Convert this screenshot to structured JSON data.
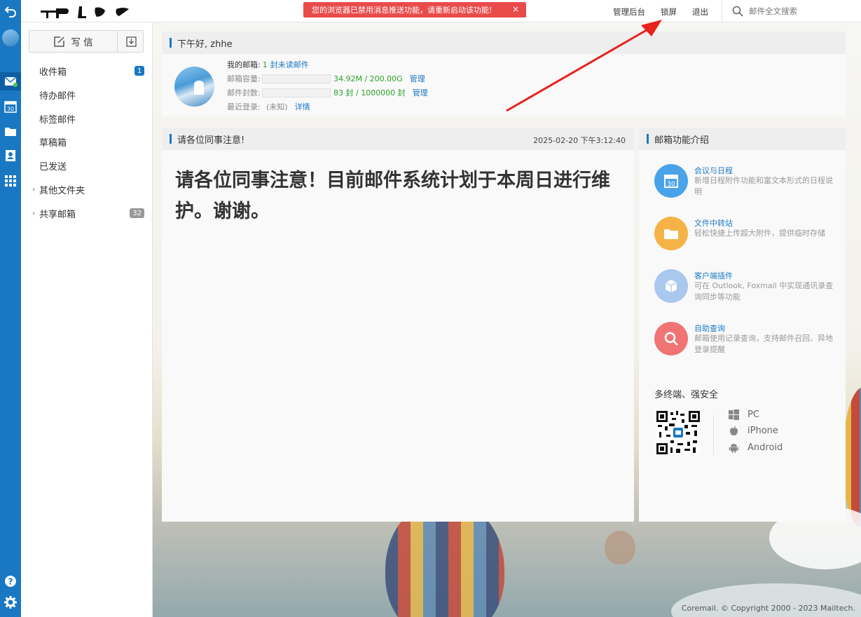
{
  "topbar": {
    "alert_text": "您的浏览器已禁用消息推送功能，请重新启动该功能!",
    "alert_close": "×",
    "admin_link": "管理后台",
    "lock_link": "锁屏",
    "logout_link": "退出",
    "search_placeholder": "邮件全文搜索"
  },
  "sidebar": {
    "compose_label": "写 信",
    "folders": [
      {
        "label": "收件箱",
        "badge": "1"
      },
      {
        "label": "待办邮件"
      },
      {
        "label": "标签邮件"
      },
      {
        "label": "草稿箱"
      },
      {
        "label": "已发送"
      },
      {
        "label": "其他文件夹"
      },
      {
        "label": "共享邮箱",
        "badge": "32"
      }
    ],
    "expand_arrow": "›"
  },
  "greeting": {
    "title": "下午好, zhhe",
    "mailbox_label": "我的邮箱:",
    "unread_count": "1",
    "unread_text": "封未读邮件",
    "capacity_label": "邮箱容量:",
    "capacity_value": "34.92M / 200.00G",
    "capacity_fraction": 0.0002,
    "count_label": "邮件封数:",
    "count_value": "83 封 / 1000000 封",
    "count_fraction": 8e-05,
    "manage_label": "管理",
    "last_login_label": "最近登录:",
    "last_login_value": "(未知)",
    "detail_link": "详情"
  },
  "notice": {
    "title": "请各位同事注意!",
    "date": "2025-02-20 下午3:12:40",
    "body": "请各位同事注意！目前邮件系统计划于本周日进行维护。谢谢。"
  },
  "features": {
    "title": "邮箱功能介绍",
    "items": [
      {
        "title": "会议与日程",
        "desc": "新增日程附件功能和富文本形式的日程说明",
        "color": "#4aa3e8",
        "icon": "calendar-icon"
      },
      {
        "title": "文件中转站",
        "desc": "轻松快捷上传超大附件，提供临时存储",
        "color": "#f5b347",
        "icon": "folder-icon"
      },
      {
        "title": "客户端插件",
        "desc": "可在 Outlook, Foxmail 中实现通讯录查询同步等功能",
        "color": "#a9c8ee",
        "icon": "cube-icon"
      },
      {
        "title": "自助查询",
        "desc": "邮箱使用记录查询，支持邮件召回、异地登录提醒",
        "color": "#f07474",
        "icon": "search-icon"
      }
    ],
    "multi_title": "多终端、强安全",
    "platforms": [
      "PC",
      "iPhone",
      "Android"
    ]
  },
  "footer": {
    "copyright": "Coremail. © Copyright 2000 - 2023 Mailtech."
  },
  "colors": {
    "brand": "#1a78c2",
    "alert": "#e94b4b",
    "green": "#2aa22a"
  }
}
